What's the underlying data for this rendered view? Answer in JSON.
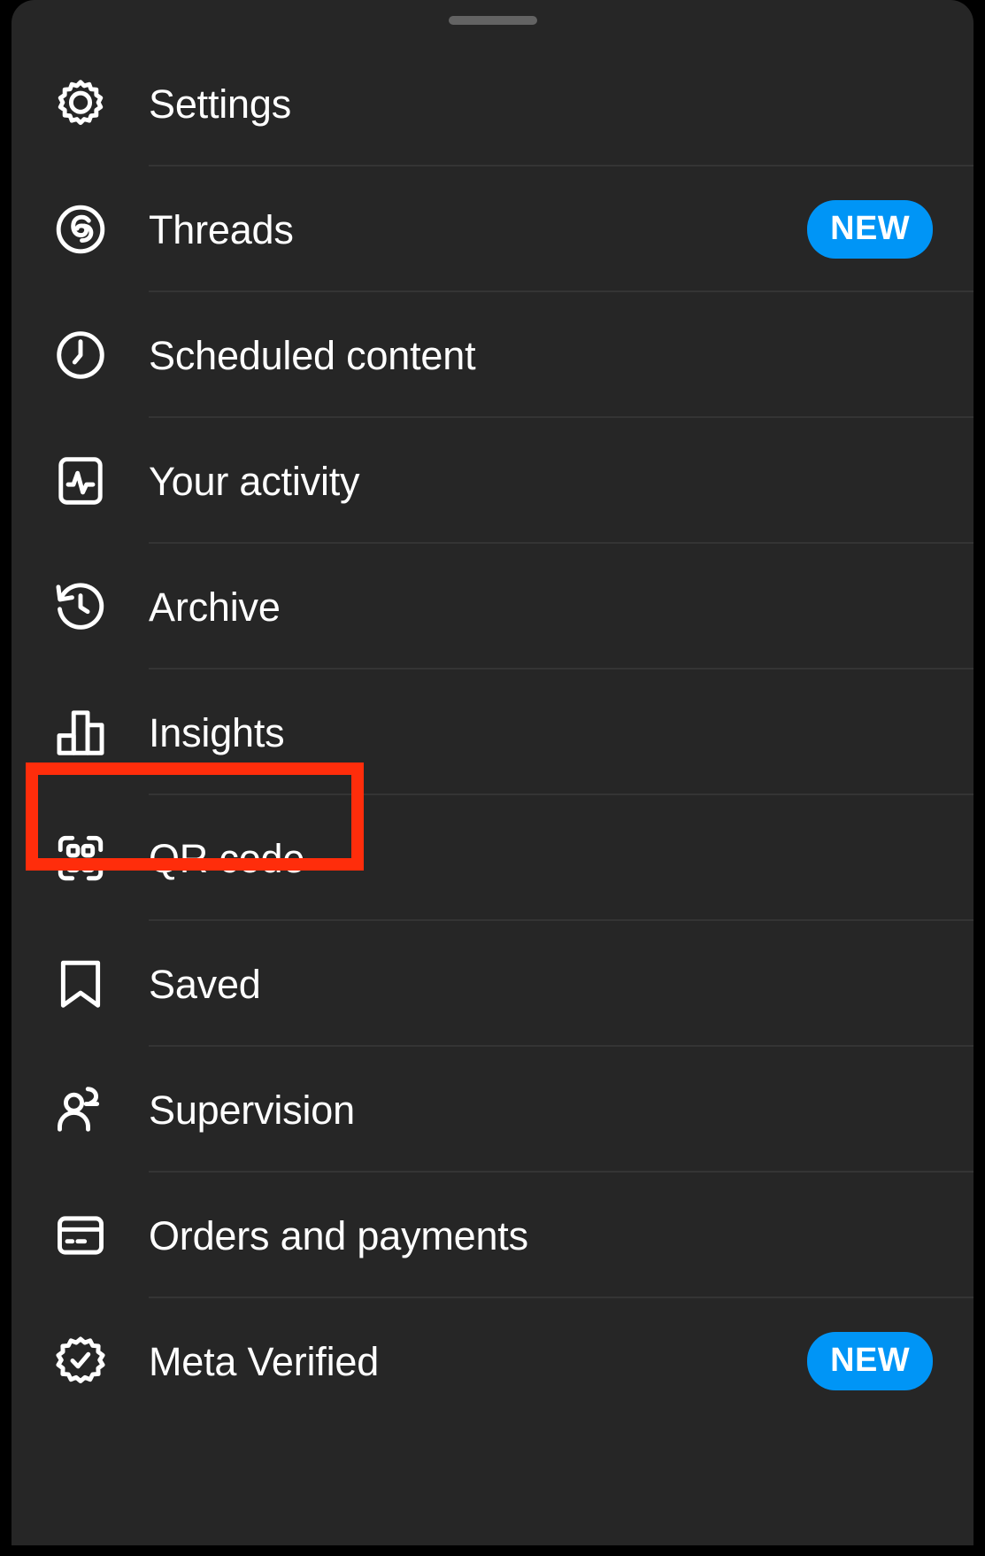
{
  "sheet": {
    "handle_name": "drag-handle",
    "background_color": "#262626",
    "divider_color": "#343434"
  },
  "badge_color": "#0095f6",
  "highlight": {
    "color": "#ff2d0b",
    "target_label": "Insights"
  },
  "menu": {
    "items": [
      {
        "label": "Settings",
        "icon": "gear-icon",
        "badge": ""
      },
      {
        "label": "Threads",
        "icon": "threads-icon",
        "badge": "NEW"
      },
      {
        "label": "Scheduled content",
        "icon": "clock-icon",
        "badge": ""
      },
      {
        "label": "Your activity",
        "icon": "activity-icon",
        "badge": ""
      },
      {
        "label": "Archive",
        "icon": "archive-icon",
        "badge": ""
      },
      {
        "label": "Insights",
        "icon": "bar-chart-icon",
        "badge": ""
      },
      {
        "label": "QR code",
        "icon": "qr-code-icon",
        "badge": ""
      },
      {
        "label": "Saved",
        "icon": "bookmark-icon",
        "badge": ""
      },
      {
        "label": "Supervision",
        "icon": "people-icon",
        "badge": ""
      },
      {
        "label": "Orders and payments",
        "icon": "card-icon",
        "badge": ""
      },
      {
        "label": "Meta Verified",
        "icon": "verified-icon",
        "badge": "NEW"
      }
    ]
  }
}
